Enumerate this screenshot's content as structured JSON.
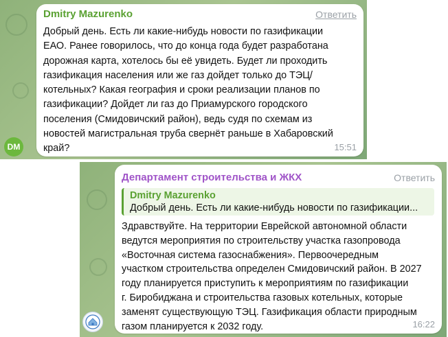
{
  "messages": [
    {
      "sender": "Dmitry Mazurenko",
      "reply_label": "Ответить",
      "text": "Добрый день. Есть ли какие-нибудь новости по газификации\nЕАО. Ранее говорилось, что до конца года будет разработана\nдорожная карта, хотелось бы её увидеть. Будет ли проходить\nгазификация населения или же газ дойдет только до ТЭЦ/\nкотельных? Какая география и сроки реализации планов по\nгазификации? Дойдет ли газ до Приамурского городского\nпоселения (Смидовичский район), ведь судя по схемам из\nновостей магистральная труба свернёт раньше в Хабаровский\nкрай?",
      "time": "15:51",
      "avatar_initials": "DM",
      "sender_color": "#5aa132"
    },
    {
      "sender": "Департамент строительства и ЖКХ",
      "reply_label": "Ответить",
      "quote": {
        "sender": "Dmitry Mazurenko",
        "text": "Добрый день. Есть ли какие-нибудь новости по газификации..."
      },
      "text": "Здравствуйте. На территории Еврейской автономной области\nведутся мероприятия по строительству участка газопровода\n«Восточная система газоснабжения». Первоочередным\nучастком строительства определен Смидовичский район. В 2027\nгоду планируется приступить к мероприятиям по газификации\nг. Биробиджана и строительства газовых котельных, которые\nзаменят существующую ТЭЦ. Газификация области природным\nгазом планируется к 2032 году.",
      "time": "16:22",
      "avatar_icon": "department-logo-icon",
      "sender_color": "#a054c8"
    }
  ]
}
